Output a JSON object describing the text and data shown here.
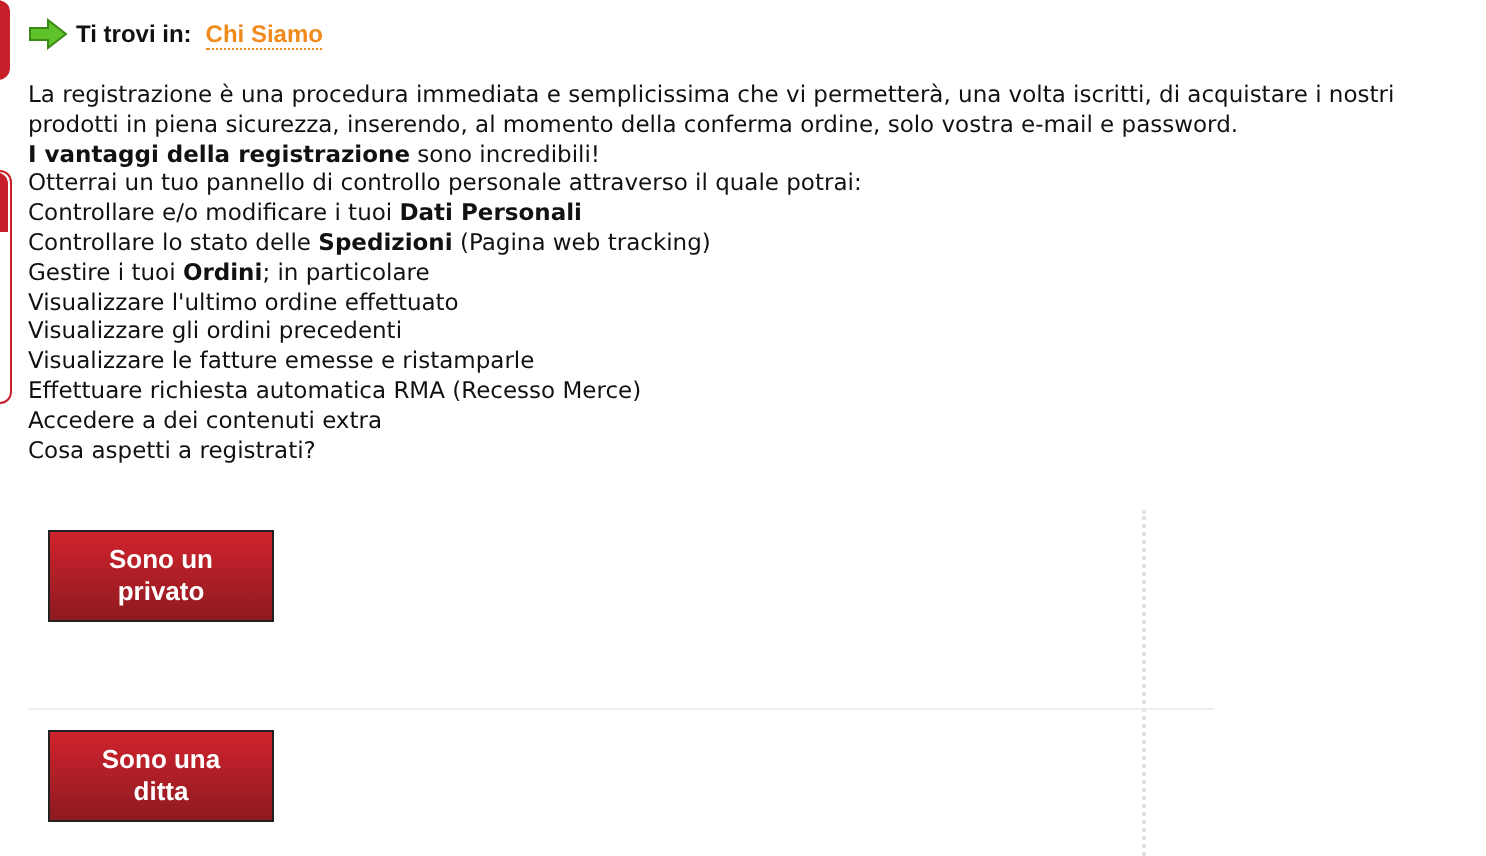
{
  "breadcrumb": {
    "label": "Ti trovi in:",
    "link": "Chi Siamo"
  },
  "paragraphs": [
    "La registrazione è una procedura immediata e semplicissima che vi permetterà, una volta iscritti, di acquistare i nostri prodotti in piena sicurezza, inserendo, al momento della conferma ordine, solo vostra e-mail e password.",
    "**I vantaggi della registrazione** sono incredibili!",
    "Otterrai un tuo pannello di controllo personale attraverso il quale potrai:",
    "Controllare e/o modificare i tuoi **Dati Personali**",
    "Controllare lo stato delle **Spedizioni** (Pagina web tracking)",
    "Gestire i tuoi **Ordini**; in particolare",
    "Visualizzare l'ultimo ordine effettuato",
    "Visualizzare gli ordini precedenti",
    "Visualizzare le fatture emesse e ristamparle",
    "Effettuare richiesta automatica RMA (Recesso Merce)",
    "Accedere a dei contenuti extra",
    "Cosa aspetti a registrati?"
  ],
  "buttons": [
    "Sono un privato",
    "Sono una ditta"
  ]
}
